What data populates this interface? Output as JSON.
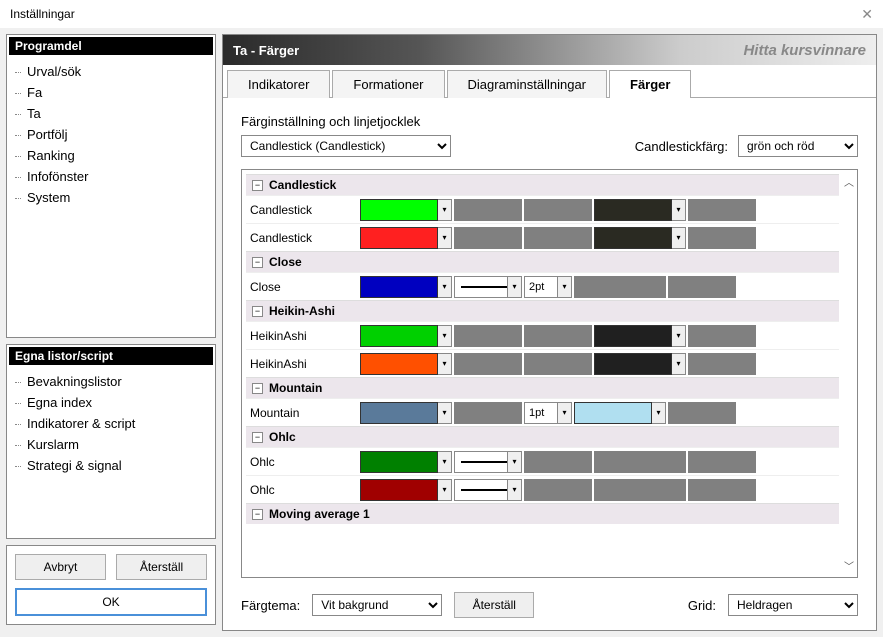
{
  "window": {
    "title": "Inställningar"
  },
  "sidebar": {
    "section_program": "Programdel",
    "section_egna": "Egna listor/script",
    "program_items": [
      "Urval/sök",
      "Fa",
      "Ta",
      "Portfölj",
      "Ranking",
      "Infofönster",
      "System"
    ],
    "egna_items": [
      "Bevakningslistor",
      "Egna index",
      "Indikatorer & script",
      "Kurslarm",
      "Strategi & signal"
    ],
    "btn_avbryt": "Avbryt",
    "btn_aterstall": "Återställ",
    "btn_ok": "OK"
  },
  "header": {
    "title": "Ta - Färger",
    "brand": "Hitta kursvinnare"
  },
  "tabs": [
    "Indikatorer",
    "Formationer",
    "Diagraminställningar",
    "Färger"
  ],
  "active_tab": "Färger",
  "row1_label": "Färginställning och linjetjocklek",
  "dd1_value": "Candlestick (Candlestick)",
  "dd2_label": "Candlestickfärg:",
  "dd2_value": "grön och röd",
  "groups": [
    {
      "name": "Candlestick",
      "rows": [
        {
          "label": "Candlestick",
          "c1": "#00ff00",
          "c2": null,
          "c3": null,
          "c4": "#2a2a22",
          "c5": null
        },
        {
          "label": "Candlestick",
          "c1": "#ff2020",
          "c2": null,
          "c3": null,
          "c4": "#2a2a22",
          "c5": null
        }
      ]
    },
    {
      "name": "Close",
      "rows": [
        {
          "label": "Close",
          "c1": "#0000c0",
          "line": true,
          "pt": "2pt"
        }
      ]
    },
    {
      "name": "Heikin-Ashi",
      "rows": [
        {
          "label": "HeikinAshi",
          "c1": "#00d000",
          "c2": null,
          "c3": null,
          "c4": "#202020",
          "c5": null
        },
        {
          "label": "HeikinAshi",
          "c1": "#ff5000",
          "c2": null,
          "c3": null,
          "c4": "#202020",
          "c5": null
        }
      ]
    },
    {
      "name": "Mountain",
      "rows": [
        {
          "label": "Mountain",
          "c1": "#5a7a9a",
          "c2": null,
          "pt": "1pt",
          "c4": "#b0dff0",
          "c5": null
        }
      ]
    },
    {
      "name": "Ohlc",
      "rows": [
        {
          "label": "Ohlc",
          "c1": "#008000",
          "line": true
        },
        {
          "label": "Ohlc",
          "c1": "#a00000",
          "line": true
        }
      ]
    },
    {
      "name": "Moving average 1",
      "rows": []
    }
  ],
  "footer": {
    "fargtema_label": "Färgtema:",
    "fargtema_value": "Vit bakgrund",
    "aterstall": "Återställ",
    "grid_label": "Grid:",
    "grid_value": "Heldragen"
  }
}
